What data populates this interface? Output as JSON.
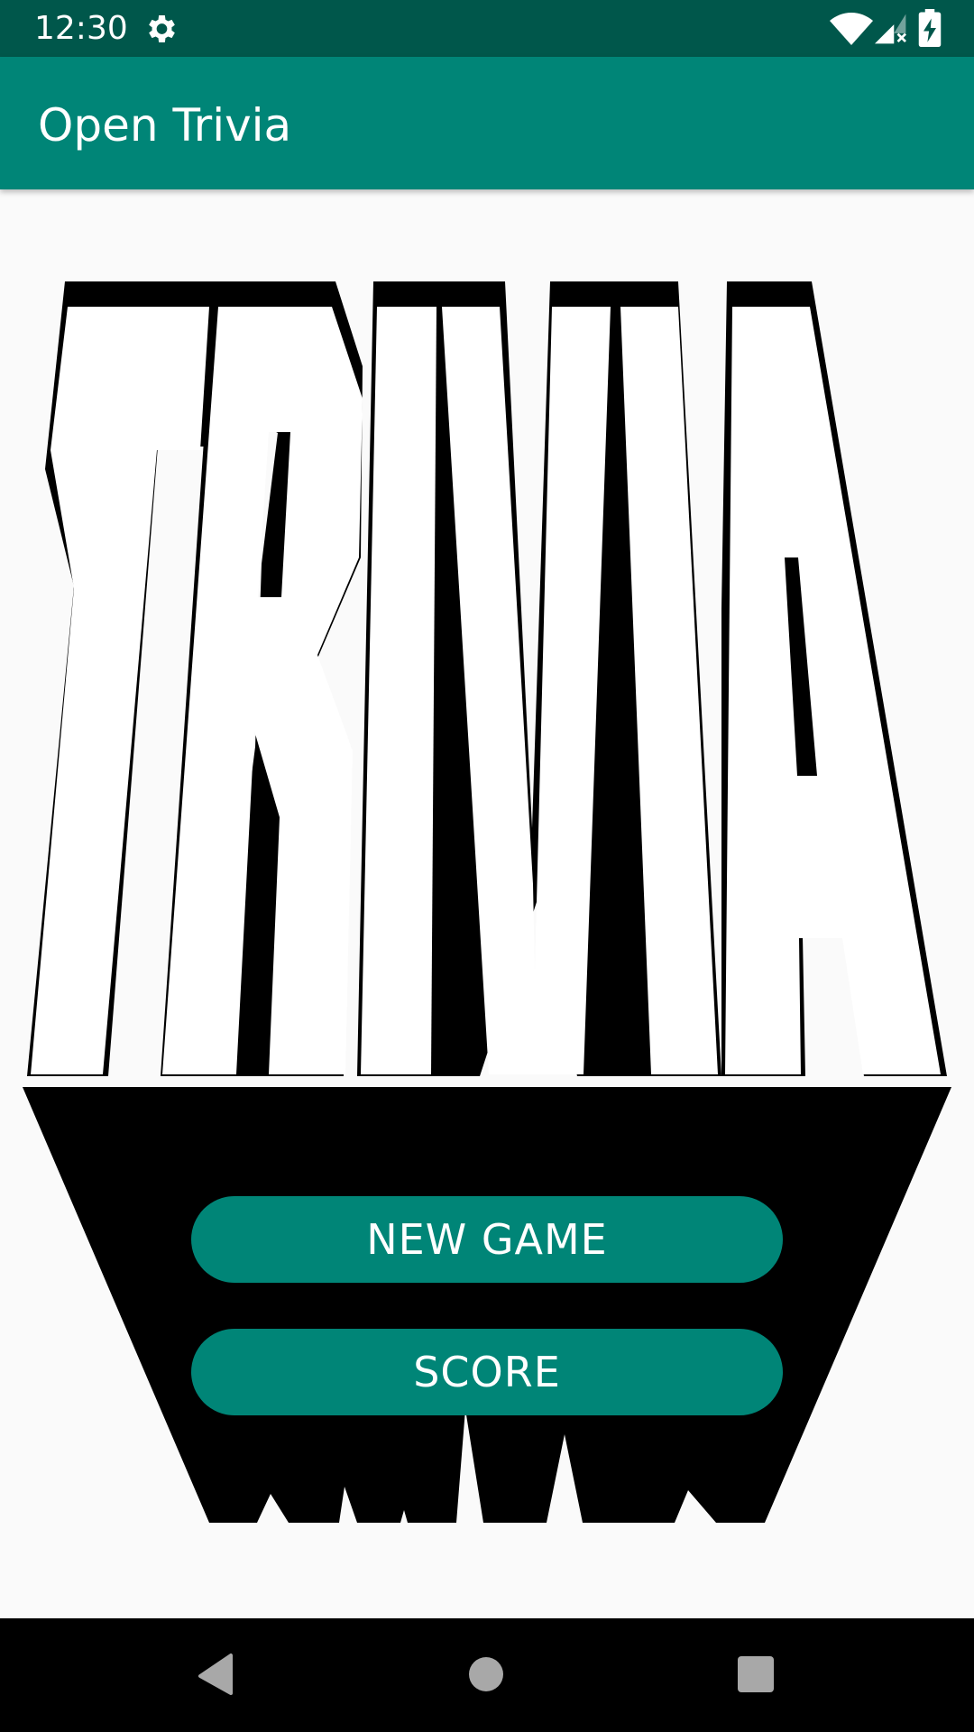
{
  "status_bar": {
    "time": "12:30",
    "icons": [
      "gear-icon",
      "wifi-icon",
      "signal-icon",
      "battery-icon"
    ],
    "background": "#00574b"
  },
  "app_bar": {
    "title": "Open Trivia",
    "background": "#008577"
  },
  "logo": {
    "text": "TRIVIA"
  },
  "buttons": {
    "new_game": "NEW GAME",
    "score": "SCORE",
    "color": "#008577"
  },
  "nav_bar": {
    "icons": [
      "back-icon",
      "home-icon",
      "recent-apps-icon"
    ]
  }
}
